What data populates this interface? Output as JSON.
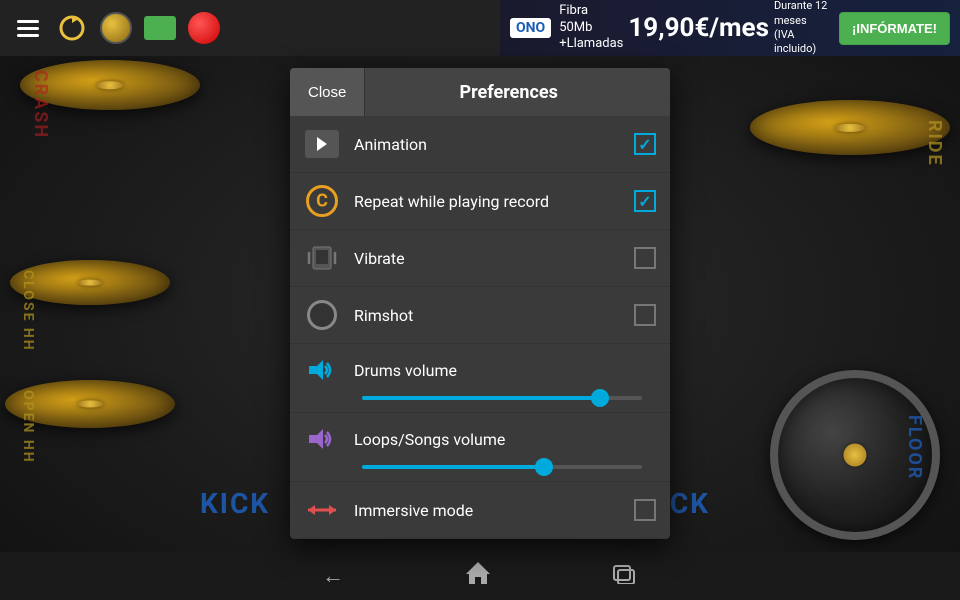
{
  "topBar": {
    "icons": [
      "menu-icon",
      "refresh-icon",
      "coin-icon",
      "green-rect-icon",
      "record-icon"
    ]
  },
  "adBanner": {
    "brand": "ONO",
    "line1": "Fibra 50Mb",
    "line2": "+Llamadas",
    "price": "19,90€/mes",
    "priceDetail1": "Durante 12 meses",
    "priceDetail2": "(IVA incluido)",
    "ctaButton": "¡INFÓRMATE!"
  },
  "drumLabels": {
    "crash": "CRASH",
    "ride": "RIDE",
    "closeHH": "CLOSE HH",
    "openHH": "OPEN HH",
    "kickLeft": "KICK",
    "kickRight": "KICK",
    "floor": "FLOOR"
  },
  "preferences": {
    "closeLabel": "Close",
    "title": "Preferences",
    "items": [
      {
        "id": "animation",
        "label": "Animation",
        "checked": true,
        "iconType": "film"
      },
      {
        "id": "repeat",
        "label": "Repeat while playing record",
        "checked": true,
        "iconType": "repeat"
      },
      {
        "id": "vibrate",
        "label": "Vibrate",
        "checked": false,
        "iconType": "vibrate"
      },
      {
        "id": "rimshot",
        "label": "Rimshot",
        "checked": false,
        "iconType": "rimshot"
      }
    ],
    "sliders": [
      {
        "id": "drums-volume",
        "label": "Drums volume",
        "iconColor": "blue",
        "value": 85,
        "fillPercent": 85
      },
      {
        "id": "loops-volume",
        "label": "Loops/Songs volume",
        "iconColor": "purple",
        "value": 65,
        "fillPercent": 65
      }
    ],
    "immersiveMode": {
      "label": "Immersive mode",
      "checked": false
    }
  },
  "bottomNav": {
    "back": "←",
    "home": "⌂",
    "recents": "▭"
  }
}
